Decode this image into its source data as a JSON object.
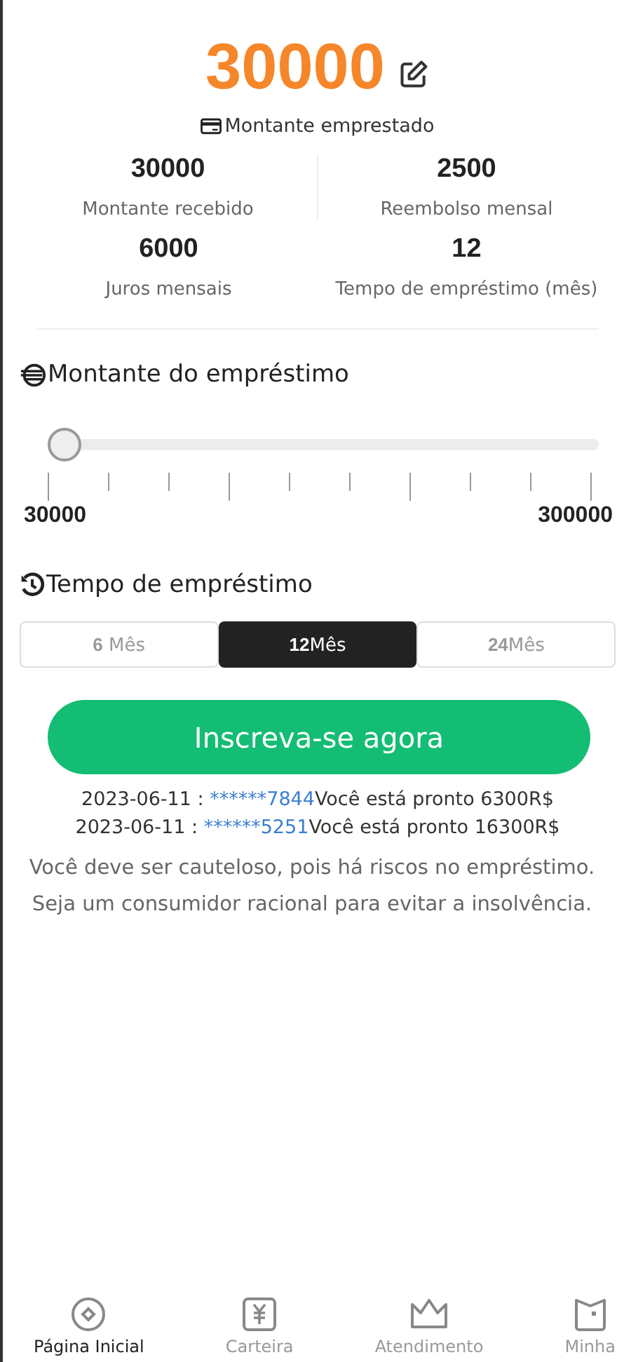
{
  "amount": {
    "value": "30000",
    "label": "Montante emprestado"
  },
  "stats": [
    {
      "value": "30000",
      "label": "Montante recebido"
    },
    {
      "value": "2500",
      "label": "Reembolso mensal"
    },
    {
      "value": "6000",
      "label": "Juros mensais"
    },
    {
      "value": "12",
      "label": "Tempo de empréstimo (mês)"
    }
  ],
  "loan_amount": {
    "title": "Montante do empréstimo",
    "level": 0,
    "min_label": "30000",
    "max_label": "300000"
  },
  "loan_term": {
    "title": "Tempo de empréstimo",
    "options": [
      {
        "number": "6",
        "unit": " Mês",
        "selected": false
      },
      {
        "number": "12",
        "unit": "Mês",
        "selected": true
      },
      {
        "number": "24",
        "unit": "Mês",
        "selected": false
      }
    ]
  },
  "apply_button": "Inscreva-se agora",
  "ticker": [
    {
      "date": "2023-06-11 : ",
      "account": "******7844",
      "message": "Você está pronto 6300R$"
    },
    {
      "date": "2023-06-11 : ",
      "account": "******5251",
      "message": "Você está pronto 16300R$"
    }
  ],
  "warning": "Você deve ser cauteloso, pois há riscos no empréstimo. Seja um consumidor racional para evitar a insolvência.",
  "tab_bar": [
    {
      "label": "Página Inicial",
      "selected": true
    },
    {
      "label": "Carteira",
      "selected": false
    },
    {
      "label": "Atendimento",
      "selected": false
    },
    {
      "label": "Minha",
      "selected": false
    }
  ]
}
